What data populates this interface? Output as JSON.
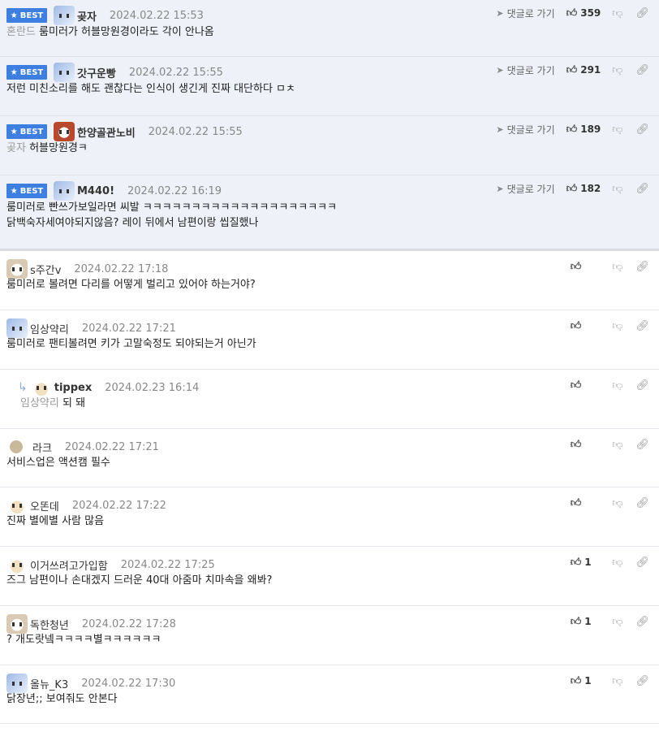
{
  "labels": {
    "best": "BEST",
    "goto_reply": "댓글로 가기"
  },
  "colors": {
    "best_badge": "#3d7fe0",
    "best_bg": "#eef1f7",
    "mention": "#999999"
  },
  "comments": [
    {
      "best": true,
      "avatar": "white-dog-avatar",
      "nick": "곶자",
      "time": "2024.02.22 15:53",
      "likes": "359",
      "mention": "혼란드",
      "lines": [
        "룸미러가 허블망원경이라도 각이 안나옴"
      ]
    },
    {
      "best": true,
      "avatar": "white-dog-avatar",
      "nick": "갓구운빵",
      "time": "2024.02.22 15:55",
      "likes": "291",
      "mention": "",
      "lines": [
        "저런 미친소리를 해도 괜찮다는 인식이 생긴게 진짜 대단하다 ㅁㅊ"
      ]
    },
    {
      "best": true,
      "avatar": "red-dog-avatar",
      "nick": "한양골관노비",
      "time": "2024.02.22 15:55",
      "likes": "189",
      "mention": "곶자",
      "lines": [
        "허블망원경ㅋ"
      ]
    },
    {
      "best": true,
      "avatar": "white-dog-avatar",
      "nick": "M440!",
      "time": "2024.02.22 16:19",
      "likes": "182",
      "mention": "",
      "lines": [
        "룸미러로 빤쓰가보일라면 씨발 ㅋㅋㅋㅋㅋㅋㅋㅋㅋㅋㅋㅋㅋㅋㅋㅋㅋㅋㅋㅋ",
        "닭백숙자세여야되지않음? 레이 뒤에서 남편이랑 씹질했나"
      ]
    },
    {
      "best": false,
      "avatar": "puppy-avatar",
      "nick": "s주간v",
      "time": "2024.02.22 17:18",
      "likes": "",
      "mention": "",
      "lines": [
        "룸미러로 볼려면 다리를 어떻게 벌리고 있어야 하는거야?"
      ]
    },
    {
      "best": false,
      "avatar": "white-dog-avatar",
      "nick": "임상약리",
      "time": "2024.02.22 17:21",
      "likes": "",
      "mention": "",
      "lines": [
        "룸미러로 팬티볼려면 키가 고말숙정도 되야되는거 아닌가"
      ]
    },
    {
      "best": false,
      "reply": true,
      "avatar": "chihuahua-avatar",
      "nick": "tippex",
      "time": "2024.02.23 16:14",
      "likes": "",
      "mention": "임상약리",
      "lines": [
        "되 돼"
      ]
    },
    {
      "best": false,
      "avatar": "beige-dot-avatar",
      "nick": "라크",
      "time": "2024.02.22 17:21",
      "likes": "",
      "mention": "",
      "lines": [
        "서비스업은 액션캠 필수"
      ]
    },
    {
      "best": false,
      "avatar": "chihuahua-avatar",
      "nick": "오똔데",
      "time": "2024.02.22 17:22",
      "likes": "",
      "mention": "",
      "lines": [
        "진짜 별에별 사람 많음"
      ]
    },
    {
      "best": false,
      "avatar": "chihuahua-avatar",
      "nick": "이거쓰려고가입함",
      "time": "2024.02.22 17:25",
      "likes": "1",
      "mention": "",
      "lines": [
        "즈그 남편이나 손대겠지 드러운 40대 아줌마 치마속을 왜봐?"
      ]
    },
    {
      "best": false,
      "avatar": "puppy-avatar",
      "nick": "독한청년",
      "time": "2024.02.22 17:28",
      "likes": "1",
      "mention": "",
      "lines": [
        "? 개도랏넼ㅋㅋㅋㅋ별ㅋㅋㅋㅋㅋㅋ"
      ]
    },
    {
      "best": false,
      "avatar": "white-dog-avatar",
      "nick": "올뉴_K3",
      "time": "2024.02.22 17:30",
      "likes": "1",
      "mention": "",
      "lines": [
        "닭장년;; 보여줘도 안본다"
      ]
    }
  ]
}
